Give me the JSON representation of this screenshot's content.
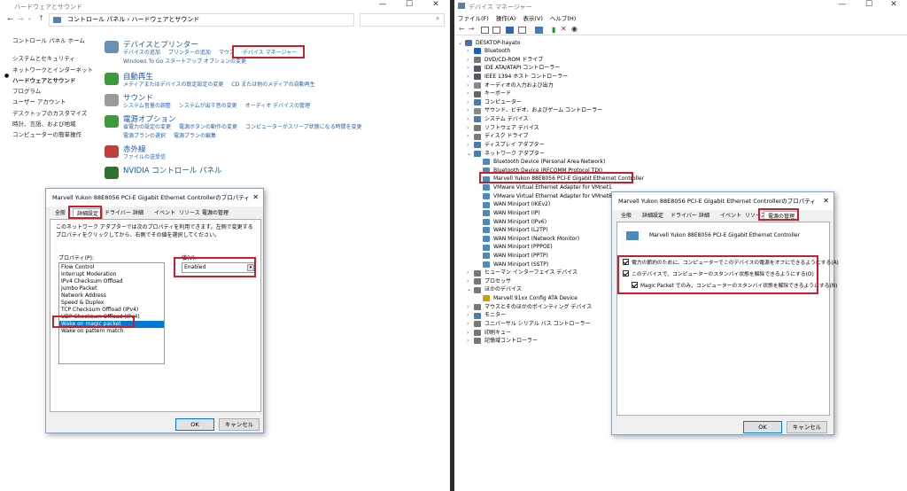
{
  "left_window": {
    "title": "ハードウェアとサウンド",
    "address": "コントロール パネル  ›  ハードウェアとサウンド",
    "nav": [
      "コントロール パネル ホーム",
      "システムとセキュリティ",
      "ネットワークとインターネット",
      "ハードウェアとサウンド",
      "プログラム",
      "ユーザー アカウント",
      "デスクトップのカスタマイズ",
      "時計、言語、および地域",
      "コンピューターの簡単操作"
    ],
    "categories": [
      {
        "title": "デバイスとプリンター",
        "links": [
          [
            "デバイスの追加",
            "プリンターの追加",
            "マウス",
            "デバイス マネージャー"
          ],
          [
            "Windows To Go スタートアップ オプションの変更"
          ]
        ],
        "icon": "printer-icon",
        "color": "#6a8fb5"
      },
      {
        "title": "自動再生",
        "links": [
          [
            "メディアまたはデバイスの既定設定の変更",
            "CD または他のメディアの自動再生"
          ]
        ],
        "icon": "autoplay-icon",
        "color": "#3c9a3c"
      },
      {
        "title": "サウンド",
        "links": [
          [
            "システム音量の調整",
            "システムが出す音の変更",
            "オーディオ デバイスの管理"
          ]
        ],
        "icon": "speaker-icon",
        "color": "#9a9a9a"
      },
      {
        "title": "電源オプション",
        "links": [
          [
            "省電力の設定の変更",
            "電源ボタンの動作の変更",
            "コンピューターがスリープ状態になる時間を変更"
          ],
          [
            "電源プランの選択",
            "電源プランの編集"
          ]
        ],
        "icon": "power-icon",
        "color": "#3c9a3c"
      },
      {
        "title": "赤外線",
        "links": [
          [
            "ファイルの送受信"
          ]
        ],
        "icon": "infrared-icon",
        "color": "#c04040"
      },
      {
        "title": "NVIDIA コントロール パネル",
        "links": [],
        "icon": "nvidia-icon",
        "color": "#2f6f2f"
      }
    ]
  },
  "prop_dialog": {
    "title": "Marvell Yukon 88E8056 PCI-E Gigabit Ethernet Controllerのプロパティ",
    "tabs": [
      "全般",
      "詳細設定",
      "ドライバー",
      "詳細",
      "イベント",
      "リソース",
      "電源の管理"
    ],
    "description": "このネットワーク アダプターでは次のプロパティを利用できます。左側で変更するプロパティをクリックしてから、右側でその値を選択してください。",
    "property_label": "プロパティ(P):",
    "value_label": "値(V):",
    "properties": [
      "Flow Control",
      "Interrupt Moderation",
      "IPv4 Checksum Offload",
      "Jumbo Packet",
      "Network Address",
      "Speed & Duplex",
      "TCP Checksum Offload (IPv4)",
      "UDP Checksum Offload (IPv4)",
      "Wake on magic packet",
      "Wake on pattern match"
    ],
    "selected_index": 8,
    "value": "Enabled",
    "ok": "OK",
    "cancel": "キャンセル"
  },
  "device_manager": {
    "title": "デバイス マネージャー",
    "menu": [
      "ファイル(F)",
      "操作(A)",
      "表示(V)",
      "ヘルプ(H)"
    ],
    "tree": [
      {
        "lvl": 0,
        "exp": "⌄",
        "t": "DESKTOP-hayato",
        "c": "#4a6fa5"
      },
      {
        "lvl": 1,
        "exp": "›",
        "t": "Bluetooth",
        "c": "#1e5fb8"
      },
      {
        "lvl": 1,
        "exp": "›",
        "t": "DVD/CD-ROM ドライブ",
        "c": "#777"
      },
      {
        "lvl": 1,
        "exp": "›",
        "t": "IDE ATA/ATAPI コントローラー",
        "c": "#556"
      },
      {
        "lvl": 1,
        "exp": "›",
        "t": "IEEE 1394 ホスト コントローラー",
        "c": "#556"
      },
      {
        "lvl": 1,
        "exp": "›",
        "t": "オーディオの入力および出力",
        "c": "#888"
      },
      {
        "lvl": 1,
        "exp": "›",
        "t": "キーボード",
        "c": "#666"
      },
      {
        "lvl": 1,
        "exp": "›",
        "t": "コンピューター",
        "c": "#4a7ab0"
      },
      {
        "lvl": 1,
        "exp": "›",
        "t": "サウンド、ビデオ、およびゲーム コントローラー",
        "c": "#888"
      },
      {
        "lvl": 1,
        "exp": "›",
        "t": "システム デバイス",
        "c": "#4a7ab0"
      },
      {
        "lvl": 1,
        "exp": "›",
        "t": "ソフトウェア デバイス",
        "c": "#777"
      },
      {
        "lvl": 1,
        "exp": "›",
        "t": "ディスク ドライブ",
        "c": "#777"
      },
      {
        "lvl": 1,
        "exp": "›",
        "t": "ディスプレイ アダプター",
        "c": "#4a7ab0"
      },
      {
        "lvl": 1,
        "exp": "⌄",
        "t": "ネットワーク アダプター",
        "c": "#4a7ab0"
      },
      {
        "lvl": 2,
        "exp": "",
        "t": "Bluetooth Device (Personal Area Network)",
        "c": "#4a8ac0"
      },
      {
        "lvl": 2,
        "exp": "",
        "t": "Bluetooth Device (RFCOMM Protocol TDI)",
        "c": "#4a8ac0"
      },
      {
        "lvl": 2,
        "exp": "",
        "t": "Marvell Yukon 88E8056 PCI-E Gigabit Ethernet Controller",
        "c": "#4a8ac0"
      },
      {
        "lvl": 2,
        "exp": "",
        "t": "VMware Virtual Ethernet Adapter for VMnet1",
        "c": "#4a8ac0"
      },
      {
        "lvl": 2,
        "exp": "",
        "t": "VMware Virtual Ethernet Adapter for VMnet8",
        "c": "#4a8ac0"
      },
      {
        "lvl": 2,
        "exp": "",
        "t": "WAN Miniport (IKEv2)",
        "c": "#4a8ac0"
      },
      {
        "lvl": 2,
        "exp": "",
        "t": "WAN Miniport (IP)",
        "c": "#4a8ac0"
      },
      {
        "lvl": 2,
        "exp": "",
        "t": "WAN Miniport (IPv6)",
        "c": "#4a8ac0"
      },
      {
        "lvl": 2,
        "exp": "",
        "t": "WAN Miniport (L2TP)",
        "c": "#4a8ac0"
      },
      {
        "lvl": 2,
        "exp": "",
        "t": "WAN Miniport (Network Monitor)",
        "c": "#4a8ac0"
      },
      {
        "lvl": 2,
        "exp": "",
        "t": "WAN Miniport (PPPOE)",
        "c": "#4a8ac0"
      },
      {
        "lvl": 2,
        "exp": "",
        "t": "WAN Miniport (PPTP)",
        "c": "#4a8ac0"
      },
      {
        "lvl": 2,
        "exp": "",
        "t": "WAN Miniport (SSTP)",
        "c": "#4a8ac0"
      },
      {
        "lvl": 1,
        "exp": "›",
        "t": "ヒューマン インターフェイス デバイス",
        "c": "#777"
      },
      {
        "lvl": 1,
        "exp": "›",
        "t": "プロセッサ",
        "c": "#777"
      },
      {
        "lvl": 1,
        "exp": "⌄",
        "t": "ほかのデバイス",
        "c": "#777"
      },
      {
        "lvl": 2,
        "exp": "",
        "t": "Marvell 91xx Config ATA Device",
        "c": "#c8a000"
      },
      {
        "lvl": 1,
        "exp": "›",
        "t": "マウスとそのほかのポインティング デバイス",
        "c": "#777"
      },
      {
        "lvl": 1,
        "exp": "›",
        "t": "モニター",
        "c": "#4a7ab0"
      },
      {
        "lvl": 1,
        "exp": "›",
        "t": "ユニバーサル シリアル バス コントローラー",
        "c": "#777"
      },
      {
        "lvl": 1,
        "exp": "›",
        "t": "印刷キュー",
        "c": "#777"
      },
      {
        "lvl": 1,
        "exp": "›",
        "t": "記憶域コントローラー",
        "c": "#777"
      }
    ]
  },
  "power_dialog": {
    "title": "Marvell Yukon 88E8056 PCI-E Gigabit Ethernet Controllerのプロパティ",
    "tabs": [
      "全般",
      "詳細設定",
      "ドライバー",
      "詳細",
      "イベント",
      "リソース",
      "電源の管理"
    ],
    "device_name": "Marvell Yukon 88E8056 PCI-E Gigabit Ethernet Controller",
    "options": [
      "電力の節約のために、コンピューターでこのデバイスの電源をオフにできるようにする(A)",
      "このデバイスで、コンピューターのスタンバイ状態を解除できるようにする(O)",
      "Magic Packet でのみ、コンピューターのスタンバイ状態を解除できるようにする(N)"
    ],
    "ok": "OK",
    "cancel": "キャンセル"
  }
}
